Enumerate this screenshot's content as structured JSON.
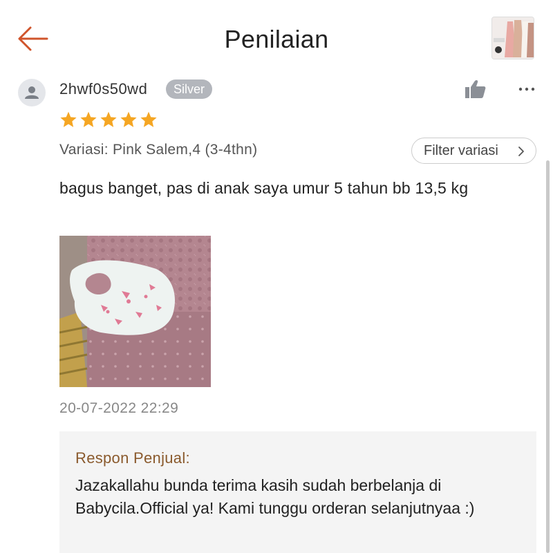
{
  "header": {
    "title": "Penilaian",
    "back_icon": "arrow-left-icon",
    "accent_color": "#d0542b"
  },
  "review": {
    "username": "2hwf0s50wd",
    "badge": "Silver",
    "rating": 5,
    "rating_max": 5,
    "star_color": "#f5a623",
    "variation": "Variasi: Pink Salem,4 (3-4thn)",
    "filter_label": "Filter variasi",
    "text": "bagus banget, pas di anak saya umur 5 tahun bb 13,5 kg",
    "timestamp": "20-07-2022 22:29"
  },
  "seller_response": {
    "title": "Respon Penjual:",
    "text": "Jazakallahu bunda terima kasih sudah berbelanja di Babycila.Official ya! Kami tunggu orderan selanjutnyaa :)"
  }
}
